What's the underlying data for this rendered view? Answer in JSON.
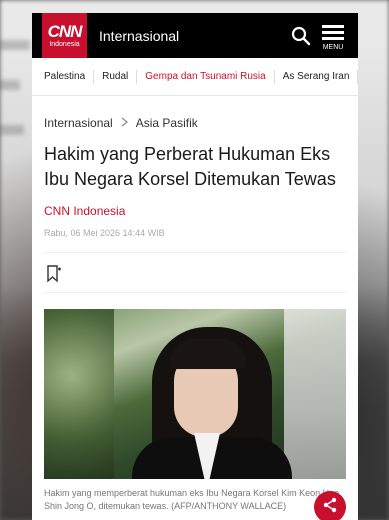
{
  "header": {
    "logo_main": "CNN",
    "logo_sub": "Indonesia",
    "section": "Internasional",
    "menu_label": "MENU"
  },
  "nav": {
    "tabs": [
      {
        "label": "Palestina"
      },
      {
        "label": "Rudal"
      },
      {
        "label": "Gempa dan Tsunami Rusia"
      },
      {
        "label": "As Serang Iran"
      }
    ]
  },
  "article": {
    "breadcrumb": [
      "Internasional",
      "Asia Pasifik"
    ],
    "headline": "Hakim yang Perberat Hukuman Eks Ibu Negara Korsel Ditemukan Tewas",
    "author": "CNN Indonesia",
    "date": "Rabu, 06 Mei 2026 14:44 WIB",
    "caption": "Hakim yang memperberat hukuman eks Ibu Negara Korsel Kim Keon Hee, Shin Jong O, ditemukan tewas. (AFP/ANTHONY WALLACE)"
  },
  "colors": {
    "brand_red": "#c8102e",
    "topbar": "#000000"
  },
  "icons": {
    "search": "search-icon",
    "menu": "hamburger-menu-icon",
    "breadcrumb_separator": "chevron-right-icon",
    "bookmark": "bookmark-icon",
    "share": "share-icon"
  }
}
